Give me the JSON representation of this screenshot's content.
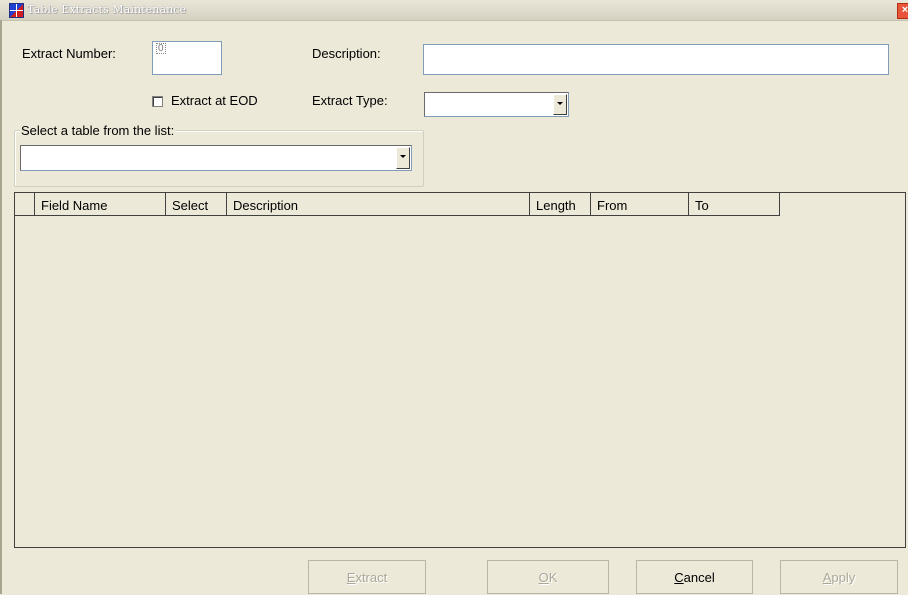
{
  "window": {
    "title": "Table Extracts Maintenance",
    "close_glyph": "×"
  },
  "form": {
    "extract_number_label": "Extract Number:",
    "extract_number_value": "0",
    "description_label": "Description:",
    "description_value": "",
    "extract_at_eod_label": "Extract at EOD",
    "extract_at_eod_checked": false,
    "extract_type_label": "Extract Type:",
    "extract_type_value": "",
    "table_group_label": "Select a table from the list:",
    "table_value": ""
  },
  "grid": {
    "columns": [
      "Field Name",
      "Select",
      "Description",
      "Length",
      "From",
      "To"
    ],
    "rows": []
  },
  "buttons": {
    "extract": {
      "access_key": "E",
      "rest": "xtract",
      "enabled": false
    },
    "ok": {
      "access_key": "O",
      "rest": "K",
      "enabled": false
    },
    "cancel": {
      "access_key": "C",
      "rest": "ancel",
      "enabled": true
    },
    "apply": {
      "access_key": "A",
      "rest": "pply",
      "enabled": false
    }
  },
  "icons": {
    "app": "app-grid-icon",
    "close": "close-icon",
    "dropdown": "chevron-down-icon"
  }
}
